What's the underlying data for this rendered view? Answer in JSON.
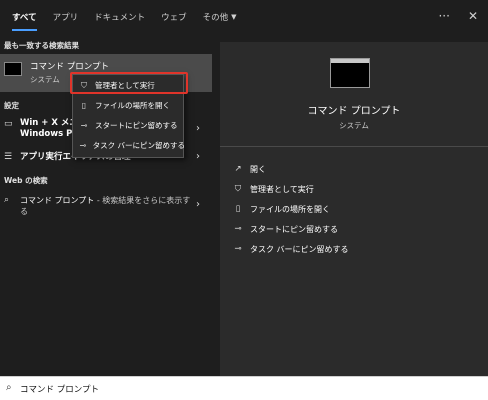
{
  "tabs": [
    {
      "label": "すべて",
      "active": true
    },
    {
      "label": "アプリ",
      "active": false
    },
    {
      "label": "ドキュメント",
      "active": false
    },
    {
      "label": "ウェブ",
      "active": false
    },
    {
      "label": "その他",
      "active": false
    }
  ],
  "top_actions": {
    "more": "···",
    "close": "✕"
  },
  "left": {
    "best_match_header": "最も一致する検索結果",
    "best_match": {
      "title": "コマンド プロンプト",
      "subtitle": "システム"
    },
    "settings_header": "設定",
    "settings_items": [
      {
        "line1": "Win + X メニ",
        "line2": "Windows Po"
      },
      {
        "line1": "アプリ実行エイリアスの管理"
      }
    ],
    "web_header": "Web の検索",
    "web_item": {
      "query": "コマンド プロンプト",
      "suffix": " - 検索結果をさらに表示す",
      "line2": "る"
    }
  },
  "context_menu": {
    "items": [
      {
        "icon": "run-as-admin-icon",
        "label": "管理者として実行"
      },
      {
        "icon": "folder-icon",
        "label": "ファイルの場所を開く"
      },
      {
        "icon": "pin-icon",
        "label": "スタートにピン留めする"
      },
      {
        "icon": "pin-icon",
        "label": "タスク バーにピン留めする"
      }
    ]
  },
  "right": {
    "app_title": "コマンド プロンプト",
    "app_subtitle": "システム",
    "actions": [
      {
        "icon": "open-icon",
        "label": "開く"
      },
      {
        "icon": "run-as-admin-icon",
        "label": "管理者として実行"
      },
      {
        "icon": "folder-icon",
        "label": "ファイルの場所を開く"
      },
      {
        "icon": "pin-icon",
        "label": "スタートにピン留めする"
      },
      {
        "icon": "pin-icon",
        "label": "タスク バーにピン留めする"
      }
    ]
  },
  "search": {
    "value": "コマンド プロンプト"
  },
  "colors": {
    "accent": "#4a9eff",
    "highlight_border": "#e0342a",
    "selected_row": "#4b4b4b",
    "panel": "#2b2b2b",
    "background": "#1e1e1e"
  }
}
